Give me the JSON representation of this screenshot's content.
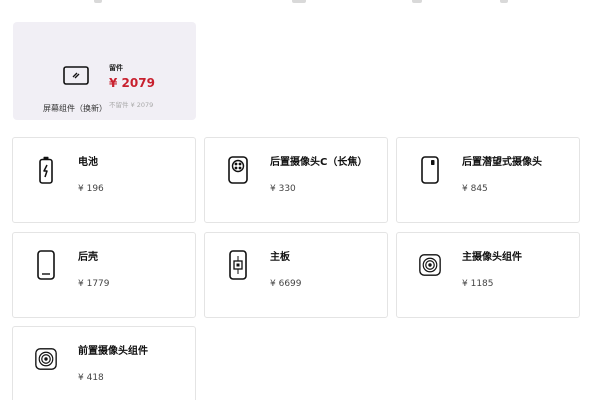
{
  "featured": {
    "tag": "留件",
    "price": "¥ 2079",
    "old_price": "不留件 ¥ 2079",
    "name": "屏幕组件（换新）",
    "icon": "screen-icon"
  },
  "parts": [
    {
      "title": "电池",
      "price": "¥ 196",
      "icon": "battery-icon"
    },
    {
      "title": "后置摄像头C（长焦）",
      "price": "¥ 330",
      "icon": "rear-camera-icon"
    },
    {
      "title": "后置潜望式摄像头",
      "price": "¥ 845",
      "icon": "periscope-camera-icon"
    },
    {
      "title": "后壳",
      "price": "¥ 1779",
      "icon": "back-cover-icon"
    },
    {
      "title": "主板",
      "price": "¥ 6699",
      "icon": "mainboard-icon"
    },
    {
      "title": "主摄像头组件",
      "price": "¥ 1185",
      "icon": "main-camera-icon"
    },
    {
      "title": "前置摄像头组件",
      "price": "¥ 418",
      "icon": "front-camera-icon"
    }
  ],
  "colors": {
    "price_red": "#c8202e",
    "feature_bg": "#f1eff5",
    "card_border": "#e4e4e4"
  }
}
